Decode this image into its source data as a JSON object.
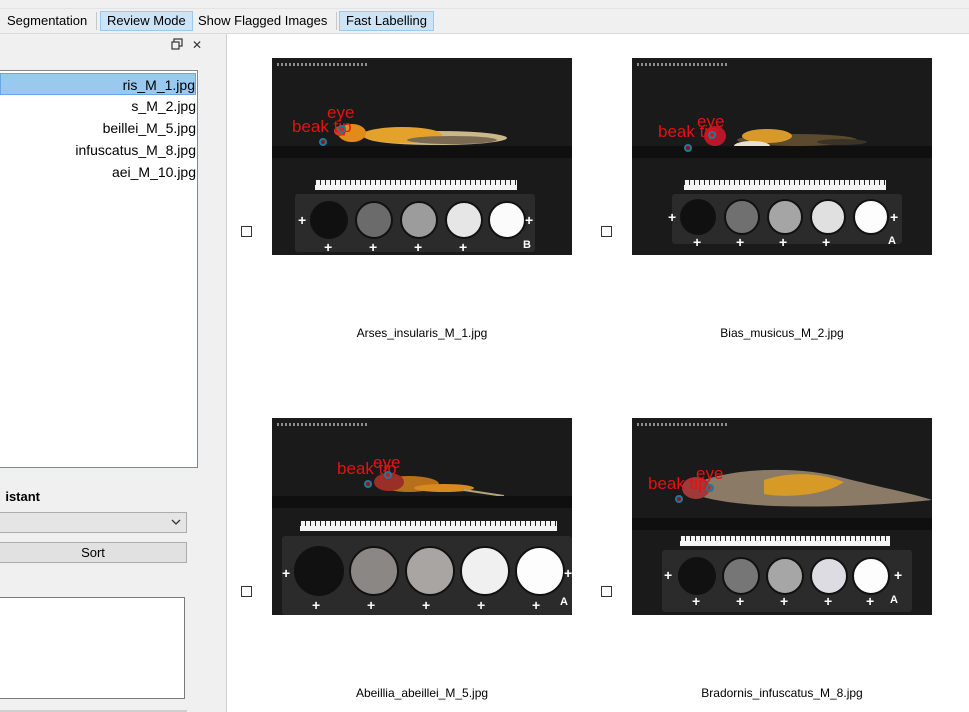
{
  "tabs": [
    {
      "label": "Segmentation",
      "active": false
    },
    {
      "label": "Review Mode",
      "active": true
    },
    {
      "label": "Show Flagged Images",
      "active": false
    },
    {
      "label": "Fast Labelling",
      "active": true
    }
  ],
  "dock": {
    "restore_icon": "🗗",
    "close_icon": "✕",
    "files": [
      {
        "label": "ris_M_1.jpg",
        "selected": true
      },
      {
        "label": "s_M_2.jpg",
        "selected": false
      },
      {
        "label": "beillei_M_5.jpg",
        "selected": false
      },
      {
        "label": "infuscatus_M_8.jpg",
        "selected": false
      },
      {
        "label": "aei_M_10.jpg",
        "selected": false
      }
    ],
    "assistant_label": "istant",
    "combo_value": "",
    "sort_label": "Sort"
  },
  "gallery": {
    "items": [
      {
        "caption": "Arses_insularis_M_1.jpg",
        "labels": {
          "eye": "eye",
          "beak": "beak tip"
        },
        "checked": false,
        "card_letter": "B"
      },
      {
        "caption": "Bias_musicus_M_2.jpg",
        "labels": {
          "eye": "eye",
          "beak": "beak tip"
        },
        "checked": false,
        "card_letter": "A"
      },
      {
        "caption": "Abeillia_abeillei_M_5.jpg",
        "labels": {
          "eye": "eye",
          "beak": "beak tip"
        },
        "checked": false,
        "card_letter": "A"
      },
      {
        "caption": "Bradornis_infuscatus_M_8.jpg",
        "labels": {
          "eye": "eye",
          "beak": "beak tip"
        },
        "checked": false,
        "card_letter": "A"
      }
    ]
  },
  "colors": {
    "accent": "#cce4f7",
    "selection": "#99c9ef",
    "label_red": "#e81010",
    "point_ring": "#1e7a9c"
  }
}
